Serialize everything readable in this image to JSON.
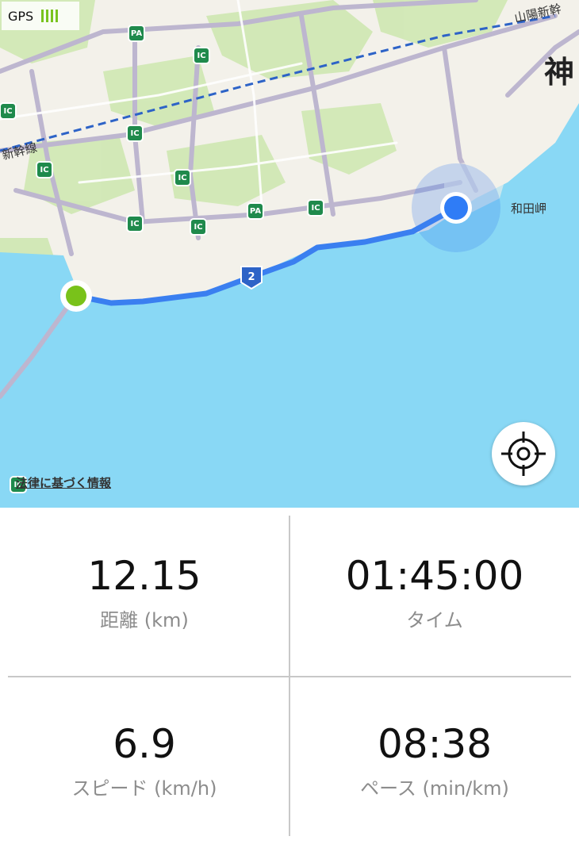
{
  "gps": {
    "label": "GPS",
    "signal_bars": 4,
    "signal_color": "#7ac31f"
  },
  "map": {
    "water_color": "#89d8f5",
    "land_color": "#f3f1ea",
    "route_color": "#3a7ff0",
    "start_marker_color": "#79c21a",
    "current_marker_color": "#2f7cf6",
    "places": {
      "kobe": "神",
      "wadamisaki": "和田岬"
    },
    "rail_labels": {
      "sanyo": "山陽新幹",
      "shinkansen": "新幹線"
    },
    "road_badges": [
      "PA",
      "IC",
      "IC",
      "IC",
      "IC",
      "IC",
      "IC",
      "IC",
      "PA",
      "IC",
      "IC"
    ],
    "route_shield": "2",
    "legal_link": "法律に基づく情報",
    "legal_overlap_badge": "IC",
    "locate_icon": "crosshair-icon"
  },
  "stats": {
    "distance": {
      "value": "12.15",
      "label": "距離 (km)"
    },
    "time": {
      "value": "01:45:00",
      "label": "タイム"
    },
    "speed": {
      "value": "6.9",
      "label": "スピード (km/h)"
    },
    "pace": {
      "value": "08:38",
      "label": "ペース (min/km)"
    }
  }
}
